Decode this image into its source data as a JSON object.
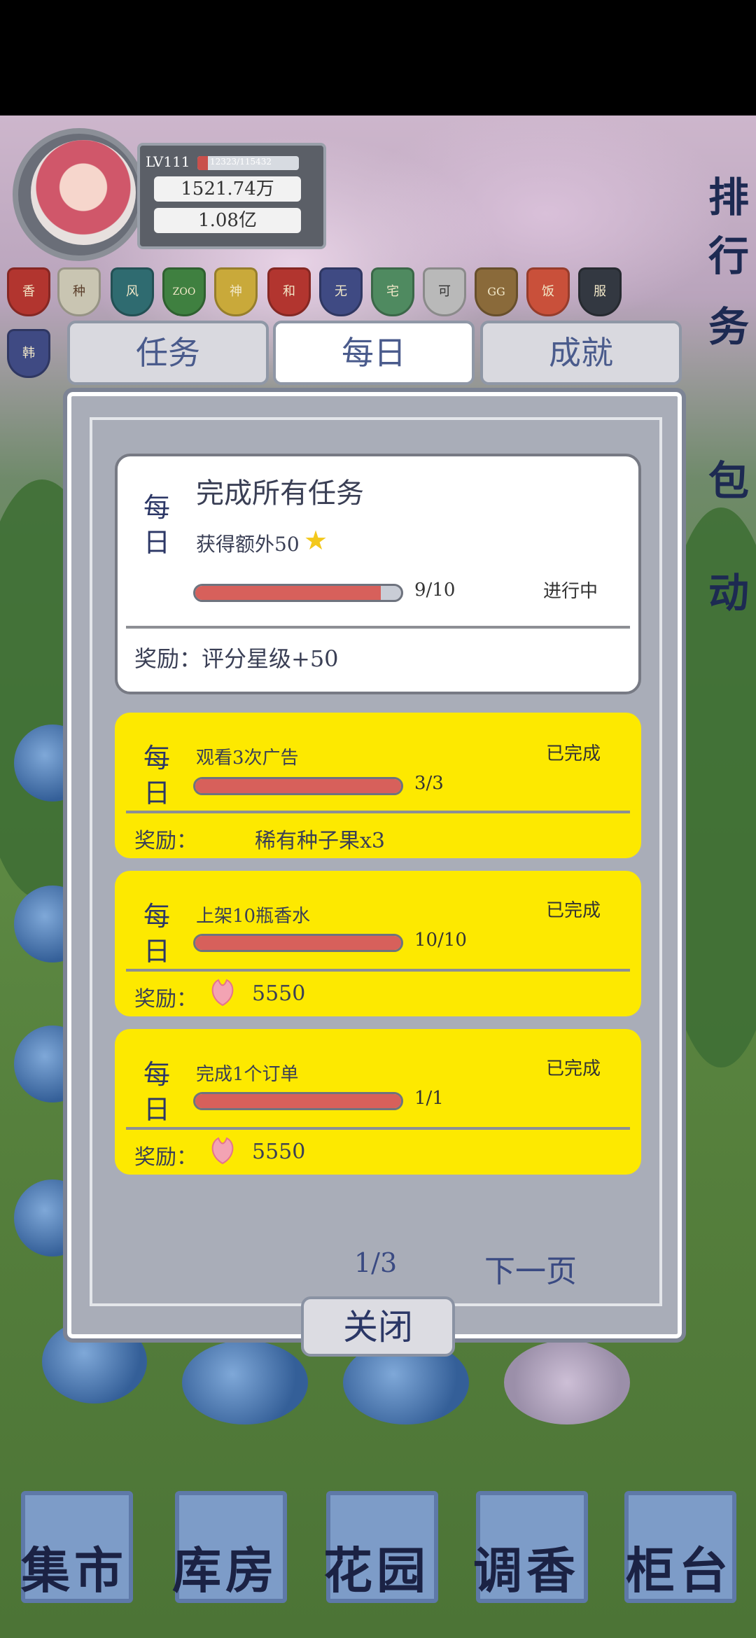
{
  "header": {
    "level": "LV111",
    "xp_text": "12323/115432",
    "xp_fraction": 0.1,
    "currency1": "1521.74万",
    "currency2": "1.08亿"
  },
  "badges": [
    "香",
    "种",
    "风",
    "ZOO",
    "神",
    "和",
    "无",
    "宅",
    "可",
    "GG",
    "饭",
    "服",
    "韩"
  ],
  "side_buttons": [
    "排行",
    "务",
    "包",
    "动"
  ],
  "tabs": [
    "任务",
    "每日",
    "成就"
  ],
  "main_task": {
    "daily_label": "每日",
    "title": "完成所有任务",
    "subtitle": "获得额外50",
    "progress_text": "9/10",
    "progress_fraction": 0.9,
    "status": "进行中",
    "reward": "奖励：评分星级+50"
  },
  "tasks": [
    {
      "daily_label": "每日",
      "title": "观看3次广告",
      "progress_text": "3/3",
      "progress_fraction": 1,
      "status": "已完成",
      "reward_label": "奖励：",
      "reward_value": "稀有种子果x3"
    },
    {
      "daily_label": "每日",
      "title": "上架10瓶香水",
      "progress_text": "10/10",
      "progress_fraction": 1,
      "status": "已完成",
      "reward_label": "奖励：",
      "reward_value": "5550"
    },
    {
      "daily_label": "每日",
      "title": "完成1个订单",
      "progress_text": "1/1",
      "progress_fraction": 1,
      "status": "已完成",
      "reward_label": "奖励：",
      "reward_value": "5550"
    }
  ],
  "pagination": {
    "page": "1/3",
    "next": "下一页"
  },
  "close_label": "关闭",
  "bottom_nav": [
    "集市",
    "库房",
    "花园",
    "调香",
    "柜台"
  ],
  "colors": {
    "done_card": "#fde900",
    "progress": "#d7605b",
    "accent": "#2c3766"
  }
}
